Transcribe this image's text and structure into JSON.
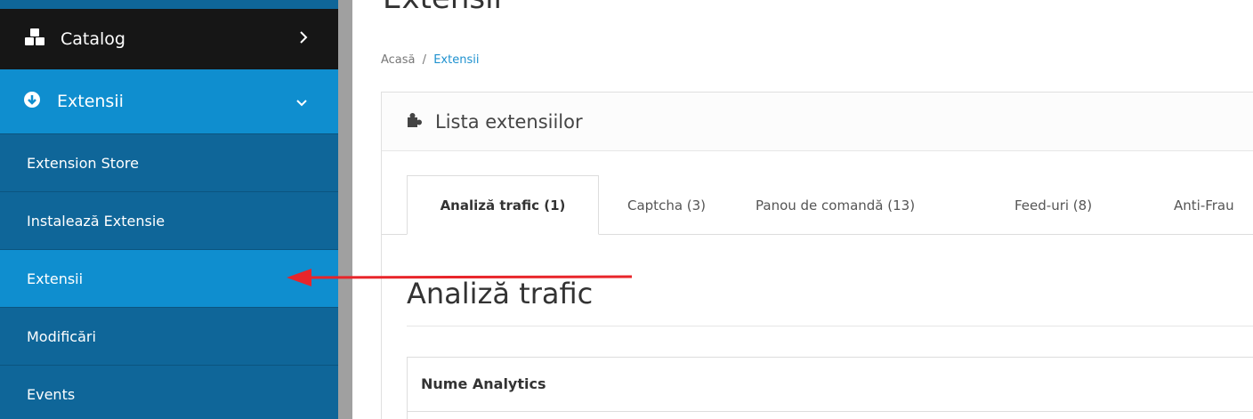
{
  "page": {
    "heading": "Extensii"
  },
  "sidebar": {
    "catalog": {
      "label": "Catalog",
      "icon": "cubes-icon"
    },
    "extensions": {
      "label": "Extensii",
      "icon": "arrow-circle-down-icon"
    },
    "submenu": [
      {
        "label": "Extension Store"
      },
      {
        "label": "Instalează Extensie"
      },
      {
        "label": "Extensii"
      },
      {
        "label": "Modificări"
      },
      {
        "label": "Events"
      }
    ]
  },
  "breadcrumb": {
    "home": "Acasă",
    "separator": "/",
    "current": "Extensii"
  },
  "panel": {
    "title": "Lista extensiilor",
    "icon": "puzzle-icon"
  },
  "tabs": [
    {
      "label": "Analiză trafic (1)"
    },
    {
      "label": "Captcha (3)"
    },
    {
      "label": "Panou de comandă (13)"
    },
    {
      "label": "Feed-uri (8)"
    },
    {
      "label": "Anti-Frau"
    }
  ],
  "section": {
    "title": "Analiză trafic"
  },
  "table": {
    "header": "Nume Analytics"
  },
  "colors": {
    "sidebar": "#0f6699",
    "sidebar_active": "#0f8ecf",
    "sidebar_top": "#161616",
    "link": "#1e91cf",
    "annotation_arrow": "#e8252a"
  }
}
